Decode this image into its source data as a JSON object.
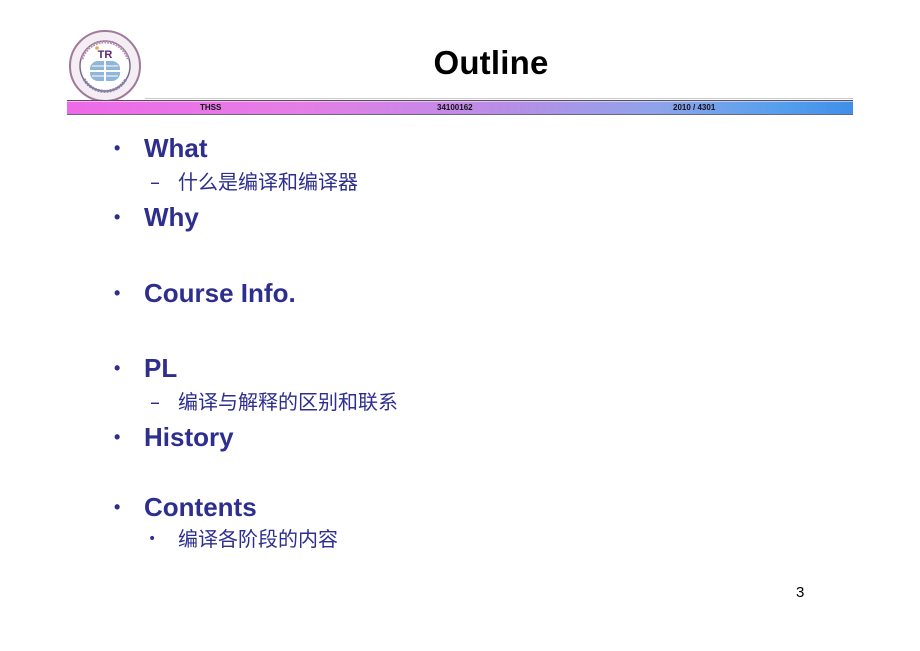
{
  "slide": {
    "title": "Outline",
    "banner": {
      "left": "THSS",
      "center": "34100162",
      "right": "2010 / 4301"
    },
    "logo_icon": "university-seal-icon",
    "items": [
      {
        "bullet": "•",
        "label": "What",
        "sub": [
          {
            "marker": "–",
            "text": "什么是编译和编译器"
          }
        ]
      },
      {
        "bullet": "•",
        "label": "Why",
        "sub": []
      },
      {
        "bullet": "•",
        "label": "Course Info.",
        "sub": []
      },
      {
        "bullet": "•",
        "label": "PL",
        "sub": [
          {
            "marker": "–",
            "text": "编译与解释的区别和联系"
          }
        ]
      },
      {
        "bullet": "•",
        "label": "History",
        "sub": []
      },
      {
        "bullet": "•",
        "label": "Contents",
        "sub": [
          {
            "marker": "•",
            "text": "编译各阶段的内容"
          }
        ]
      }
    ],
    "page_number": "3",
    "colors": {
      "text_accent": "#2e2e8f",
      "banner_start": "#ee6ae8",
      "banner_end": "#3f8fe8"
    }
  }
}
